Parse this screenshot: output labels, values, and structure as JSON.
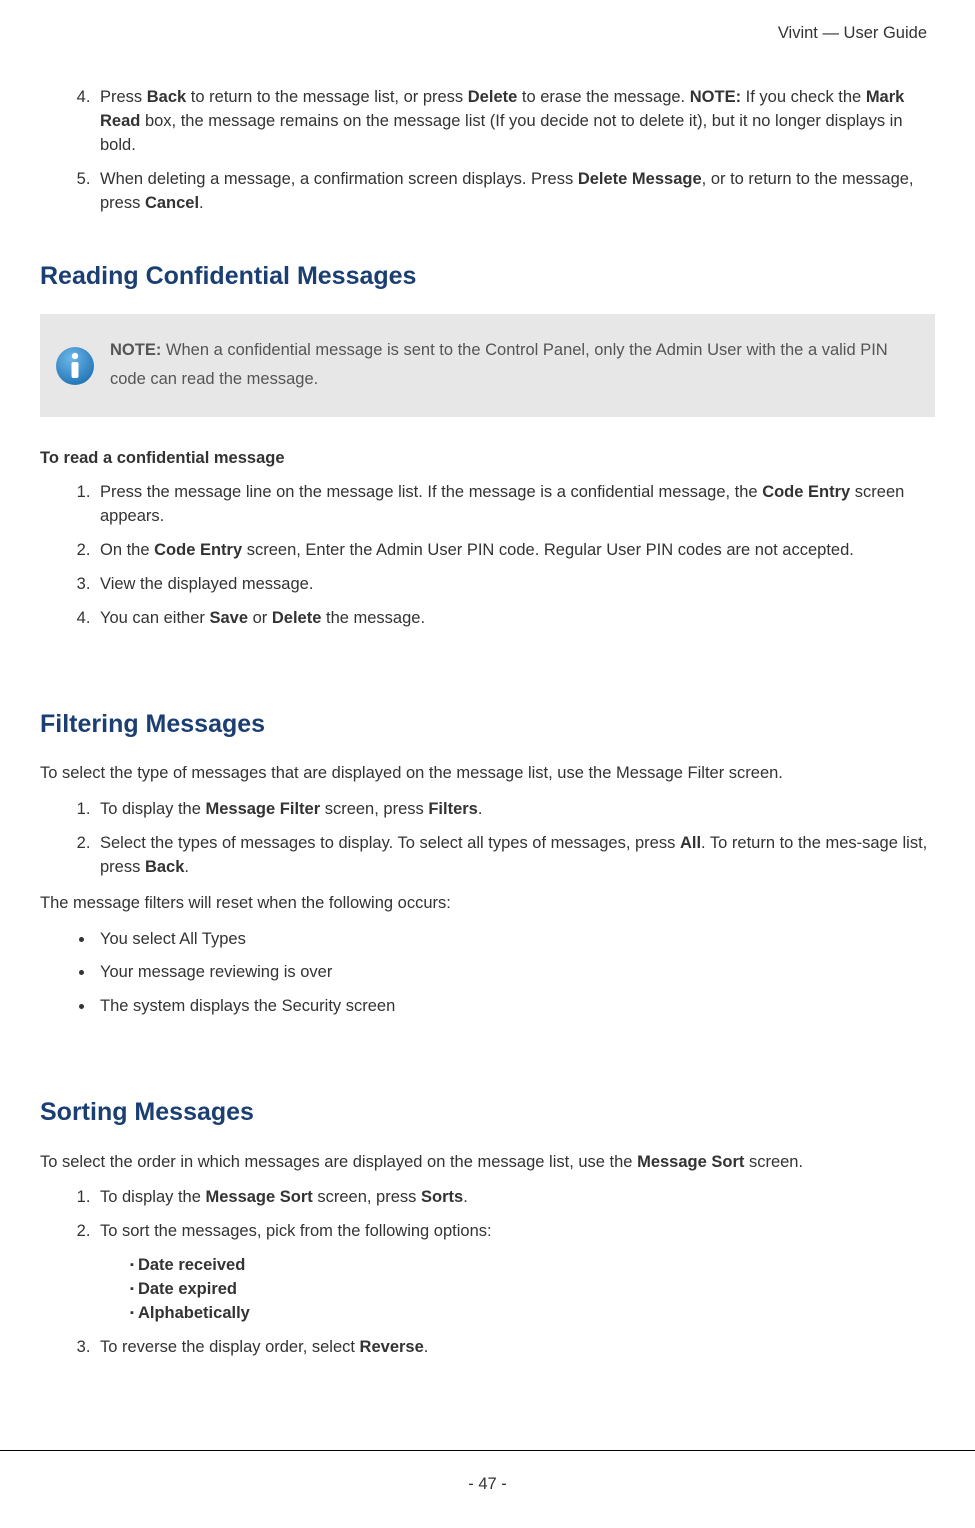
{
  "header": {
    "title": "Vivint — User Guide"
  },
  "section1": {
    "items": [
      {
        "pre": "Press ",
        "b1": "Back",
        "mid1": " to return to the message list, or press ",
        "b2": "Delete",
        "mid2": " to erase the message. ",
        "b3": "NOTE:",
        "mid3": " If you check the ",
        "b4": "Mark Read",
        "post": " box, the message remains on the message list (If you decide not to delete it), but it no longer displays in bold."
      },
      {
        "pre": "When deleting a message, a confirmation screen displays. Press ",
        "b1": "Delete Message",
        "mid1": ", or to return to the message, press ",
        "b2": "Cancel",
        "post": "."
      }
    ]
  },
  "reading": {
    "heading": "Reading Confidential Messages",
    "note_label": "NOTE:",
    "note_text": " When a confidential message is sent to the Control Panel, only the Admin User with the a valid PIN code can read the message.",
    "subhead": "To read a confidential message",
    "items": [
      {
        "pre": "Press the message line on the message list. If the message is a confidential message, the ",
        "b1": "Code Entry",
        "post": " screen appears."
      },
      {
        "pre": "On the ",
        "b1": "Code Entry",
        "post": " screen, Enter the Admin User PIN code. Regular User PIN codes are not accepted."
      },
      {
        "text": "View the displayed message."
      },
      {
        "pre": "You can either ",
        "b1": "Save",
        "mid1": " or ",
        "b2": "Delete",
        "post": " the message."
      }
    ]
  },
  "filtering": {
    "heading": "Filtering Messages",
    "intro": "To select the type of messages that are displayed on the message list, use the Message Filter screen.",
    "items": [
      {
        "pre": "To display the ",
        "b1": "Message Filter",
        "mid1": " screen, press ",
        "b2": "Filters",
        "post": "."
      },
      {
        "pre": "Select the types of messages to display. To select all types of messages, press ",
        "b1": "All",
        "mid1": ". To return to the mes-sage list, press ",
        "b2": "Back",
        "post": "."
      }
    ],
    "reset_intro": "The message filters will reset when the following occurs:",
    "bullets": [
      "You select All Types",
      "Your message reviewing is over",
      "The system displays the Security screen"
    ]
  },
  "sorting": {
    "heading": "Sorting Messages",
    "intro_pre": "To select the order in which messages are displayed on the message list, use the ",
    "intro_b": "Message Sort",
    "intro_post": " screen.",
    "items": [
      {
        "pre": "To display the ",
        "b1": "Message Sort",
        "mid1": " screen, press ",
        "b2": "Sorts",
        "post": "."
      },
      {
        "text": "To sort the messages, pick from the following options:"
      }
    ],
    "options": [
      "Date received",
      "Date expired",
      "Alphabetically"
    ],
    "item3_pre": "To reverse the display order, select ",
    "item3_b": "Reverse",
    "item3_post": "."
  },
  "footer": {
    "page": "- 47 -"
  }
}
